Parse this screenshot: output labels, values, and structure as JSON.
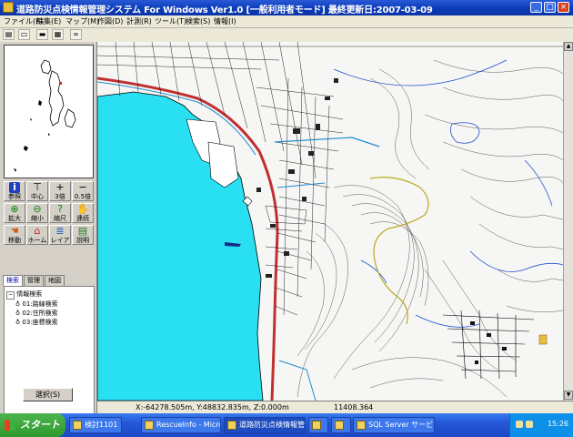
{
  "window": {
    "title": "道路防災点検情報管理システム For Windows Ver1.0 [一般利用者モード]  最終更新日:2007-03-09",
    "buttons": {
      "minimize": "_",
      "maximize": "□",
      "close": "×"
    }
  },
  "menu": [
    "ファイル(F)",
    "編集(E)",
    "マップ(M)",
    "作図(D)",
    "計測(R)",
    "ツール(T)",
    "検索(S)",
    "情報(I)"
  ],
  "tools": {
    "row1": [
      {
        "icon": "info-icon",
        "label": "参照"
      },
      {
        "icon": "center-icon",
        "label": "中心"
      },
      {
        "icon": "crosshair-icon",
        "label": "3倍"
      },
      {
        "icon": "minus-icon",
        "label": "0.5倍"
      }
    ],
    "row2": [
      {
        "icon": "zoom-in-icon",
        "label": "拡大"
      },
      {
        "icon": "zoom-out-icon",
        "label": "縮小"
      },
      {
        "icon": "zoom-help-icon",
        "label": "縮尺"
      },
      {
        "icon": "hand-icon",
        "label": "連続"
      }
    ],
    "row3": [
      {
        "icon": "pan-hand-icon",
        "label": "移動"
      },
      {
        "icon": "home-icon",
        "label": "ホーム"
      },
      {
        "icon": "layer-icon",
        "label": "レイア"
      },
      {
        "icon": "print-icon",
        "label": "説明"
      }
    ]
  },
  "tabs": [
    "検索",
    "管理",
    "地図"
  ],
  "tree": {
    "root": "情報検索",
    "items": [
      "01:路線検索",
      "02:住所検索",
      "03:座標検索"
    ]
  },
  "select_button": "選択(S)",
  "status": {
    "coordinates": "X:-64278.505m, Y:48832.835m, Z:0.000m",
    "scale": "11408.364"
  },
  "taskbar": {
    "start": "スタート",
    "tasks": [
      "検討1101",
      "RescueInfo - Micros...",
      "道路防災点検情報管...",
      "",
      "",
      "SQL Server サービス..."
    ],
    "clock": "15:26"
  },
  "colors": {
    "titlebar": "#0a3cb8",
    "sea": "#29e0f2",
    "taskbar": "#2458d8",
    "start": "#2f9a30"
  }
}
